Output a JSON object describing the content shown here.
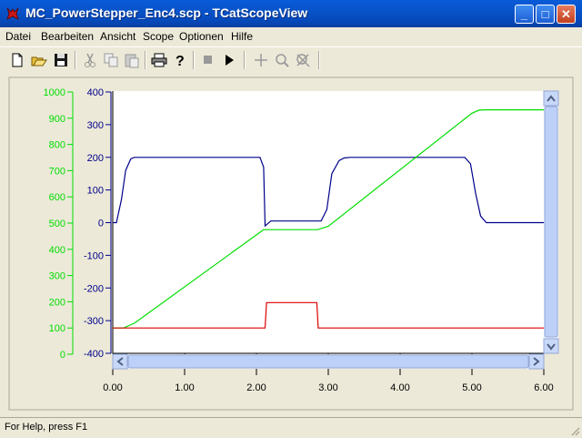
{
  "window": {
    "title": "MC_PowerStepper_Enc4.scp - TCatScopeView"
  },
  "menu": [
    "Datei",
    "Bearbeiten",
    "Ansicht",
    "Scope",
    "Optionen",
    "Hilfe"
  ],
  "toolbar_icons": [
    "new-icon",
    "open-icon",
    "save-icon",
    "cut-icon",
    "copy-icon",
    "paste-icon",
    "print-icon",
    "help-icon",
    "stop-icon",
    "play-icon",
    "crosshair-icon",
    "zoom-icon",
    "zoom-reset-icon"
  ],
  "status": {
    "text": "For Help, press F1"
  },
  "colors": {
    "green": "#00dd00",
    "blue": "#00008b",
    "red": "#dd0000"
  },
  "chart_data": {
    "type": "line",
    "x_ticks": [
      "0.00",
      "1.00",
      "2.00",
      "3.00",
      "4.00",
      "5.00",
      "6.00"
    ],
    "xlim": [
      0,
      6
    ],
    "axis_left_green": {
      "ticks": [
        "0",
        "100",
        "200",
        "300",
        "400",
        "500",
        "600",
        "700",
        "800",
        "900",
        "1000"
      ],
      "range": [
        0,
        1000
      ]
    },
    "axis_left_blue": {
      "ticks": [
        "-400",
        "-300",
        "-200",
        "-100",
        "0",
        "100",
        "200",
        "300",
        "400"
      ],
      "range": [
        -400,
        400
      ]
    },
    "series": [
      {
        "axis": "blue",
        "color": "#00008b",
        "x": [
          0.0,
          0.05,
          0.12,
          0.18,
          0.25,
          0.3,
          2.05,
          2.1,
          2.12,
          2.2,
          2.5,
          2.9,
          2.98,
          3.05,
          3.15,
          3.22,
          3.3,
          4.9,
          4.98,
          5.05,
          5.12,
          5.2,
          5.4,
          6.0
        ],
        "y": [
          0,
          0,
          70,
          160,
          195,
          200,
          200,
          170,
          -10,
          5,
          5,
          5,
          40,
          150,
          190,
          198,
          200,
          200,
          180,
          90,
          20,
          0,
          0,
          0
        ]
      },
      {
        "axis": "green",
        "color": "#00dd00",
        "x": [
          0.0,
          0.15,
          0.3,
          2.1,
          2.85,
          3.0,
          5.0,
          5.1,
          5.2,
          6.0
        ],
        "y": [
          100,
          100,
          118,
          475,
          475,
          488,
          919,
          931,
          932,
          932
        ]
      },
      {
        "axis": "green",
        "color": "#dd0000",
        "x": [
          0.0,
          2.12,
          2.14,
          2.84,
          2.86,
          6.0
        ],
        "y": [
          100,
          100,
          197,
          197,
          100,
          100
        ]
      }
    ]
  }
}
